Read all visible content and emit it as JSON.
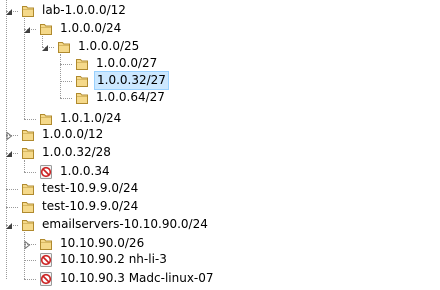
{
  "tree": {
    "nodes": [
      {
        "label": "lab-1.0.0.0/12",
        "depth": 0,
        "type": "folder",
        "expanded": true
      },
      {
        "label": "1.0.0.0/24",
        "depth": 1,
        "type": "folder",
        "expanded": true
      },
      {
        "label": "1.0.0.0/25",
        "depth": 2,
        "type": "folder",
        "expanded": true
      },
      {
        "label": "1.0.0.0/27",
        "depth": 3,
        "type": "folder"
      },
      {
        "label": "1.0.0.32/27",
        "depth": 3,
        "type": "folder",
        "selected": true
      },
      {
        "label": "1.0.0.64/27",
        "depth": 3,
        "type": "folder"
      },
      {
        "label": "1.0.1.0/24",
        "depth": 1,
        "type": "folder"
      },
      {
        "label": "1.0.0.0/12",
        "depth": 0,
        "type": "folder",
        "expanded": false
      },
      {
        "label": "1.0.0.32/28",
        "depth": 0,
        "type": "folder",
        "expanded": true
      },
      {
        "label": "1.0.0.34",
        "depth": 1,
        "type": "host"
      },
      {
        "label": "test-10.9.9.0/24",
        "depth": 0,
        "type": "folder"
      },
      {
        "label": "test-10.9.9.0/24",
        "depth": 0,
        "type": "folder"
      },
      {
        "label": "emailservers-10.10.90.0/24",
        "depth": 0,
        "type": "folder",
        "expanded": true
      },
      {
        "label": "10.10.90.0/26",
        "depth": 1,
        "type": "folder",
        "expanded": false
      },
      {
        "label": "10.10.90.2 nh-li-3",
        "depth": 1,
        "type": "host"
      },
      {
        "label": "10.10.90.3 Madc-linux-07",
        "depth": 1,
        "type": "host"
      }
    ]
  },
  "icons": {
    "folder": "folder-icon",
    "host": "blocked-host-icon",
    "expanded": "expanded-triangle-icon",
    "collapsed": "collapsed-triangle-icon"
  },
  "colors": {
    "selection_bg": "#cce8ff",
    "selection_border": "#99d1ff",
    "folder_fill": "#f5d98a",
    "folder_stroke": "#b08a2e",
    "blocked_red": "#cc2222",
    "tree_lines": "#9a9a9a"
  }
}
